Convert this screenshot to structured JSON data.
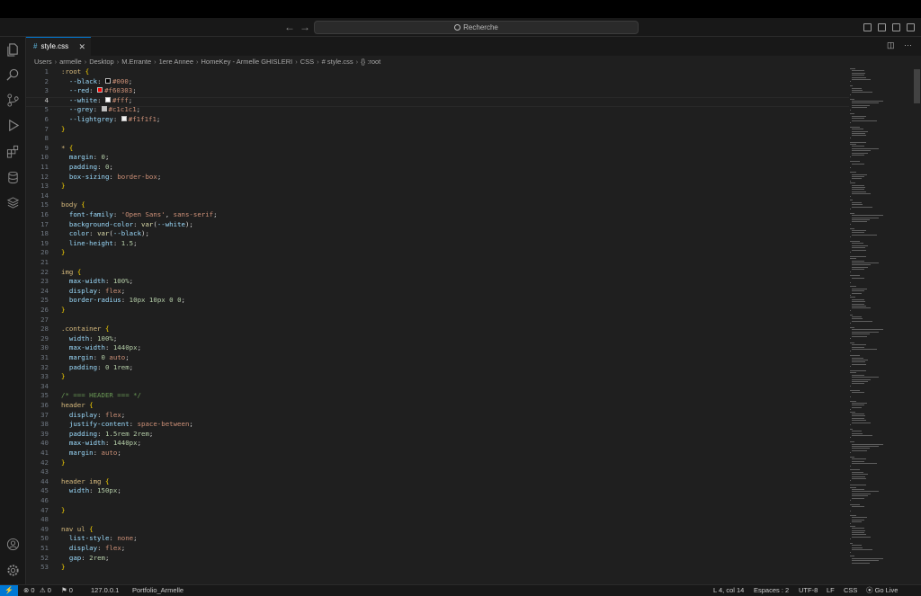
{
  "titlebar": {
    "search_placeholder": "Recherche",
    "back": "←",
    "forward": "→"
  },
  "tab": {
    "file_name": "style.css",
    "icon": "#",
    "close": "✕"
  },
  "tab_actions": {
    "split": "◫",
    "more": "···"
  },
  "breadcrumb": [
    "Users",
    "armelle",
    "Desktop",
    "M.Errante",
    "1ere Annee",
    "HomeKey - Armelle GHISLERI",
    "CSS",
    "# style.css",
    "{} :root"
  ],
  "editor": {
    "active_line": 4,
    "lines": [
      [
        [
          "t-sel",
          ":root "
        ],
        [
          "t-brace",
          "{"
        ]
      ],
      [
        [
          "",
          "  "
        ],
        [
          "t-prop",
          "--black"
        ],
        [
          "t-punc",
          ": "
        ],
        [
          "sw:#000000",
          ""
        ],
        [
          "t-val",
          "#000"
        ],
        [
          "t-punc",
          ";"
        ]
      ],
      [
        [
          "",
          "  "
        ],
        [
          "t-prop",
          "--red"
        ],
        [
          "t-punc",
          ": "
        ],
        [
          "sw:#f60303",
          ""
        ],
        [
          "t-val",
          "#f60303"
        ],
        [
          "t-punc",
          ";"
        ]
      ],
      [
        [
          "",
          "  "
        ],
        [
          "t-prop",
          "--white"
        ],
        [
          "t-punc",
          ": "
        ],
        [
          "sw:#ffffff",
          ""
        ],
        [
          "t-val",
          "#fff"
        ],
        [
          "t-punc",
          ";"
        ]
      ],
      [
        [
          "",
          "  "
        ],
        [
          "t-prop",
          "--grey"
        ],
        [
          "t-punc",
          ": "
        ],
        [
          "sw:#c1c1c1",
          ""
        ],
        [
          "t-val",
          "#c1c1c1"
        ],
        [
          "t-punc",
          ";"
        ]
      ],
      [
        [
          "",
          "  "
        ],
        [
          "t-prop",
          "--lightgrey"
        ],
        [
          "t-punc",
          ": "
        ],
        [
          "sw:#f1f1f1",
          ""
        ],
        [
          "t-val",
          "#f1f1f1"
        ],
        [
          "t-punc",
          ";"
        ]
      ],
      [
        [
          "t-brace",
          "}"
        ]
      ],
      [],
      [
        [
          "t-sel",
          "* "
        ],
        [
          "t-brace",
          "{"
        ]
      ],
      [
        [
          "",
          "  "
        ],
        [
          "t-prop",
          "margin"
        ],
        [
          "t-punc",
          ": "
        ],
        [
          "t-num",
          "0"
        ],
        [
          "t-punc",
          ";"
        ]
      ],
      [
        [
          "",
          "  "
        ],
        [
          "t-prop",
          "padding"
        ],
        [
          "t-punc",
          ": "
        ],
        [
          "t-num",
          "0"
        ],
        [
          "t-punc",
          ";"
        ]
      ],
      [
        [
          "",
          "  "
        ],
        [
          "t-prop",
          "box-sizing"
        ],
        [
          "t-punc",
          ": "
        ],
        [
          "t-val",
          "border-box"
        ],
        [
          "t-punc",
          ";"
        ]
      ],
      [
        [
          "t-brace",
          "}"
        ]
      ],
      [],
      [
        [
          "t-sel",
          "body "
        ],
        [
          "t-brace",
          "{"
        ]
      ],
      [
        [
          "",
          "  "
        ],
        [
          "t-prop",
          "font-family"
        ],
        [
          "t-punc",
          ": "
        ],
        [
          "t-val",
          "'Open Sans'"
        ],
        [
          "t-punc",
          ", "
        ],
        [
          "t-val",
          "sans-serif"
        ],
        [
          "t-punc",
          ";"
        ]
      ],
      [
        [
          "",
          "  "
        ],
        [
          "t-prop",
          "background-color"
        ],
        [
          "t-punc",
          ": "
        ],
        [
          "t-fn",
          "var"
        ],
        [
          "t-punc",
          "("
        ],
        [
          "t-prop",
          "--white"
        ],
        [
          "t-punc",
          ");"
        ]
      ],
      [
        [
          "",
          "  "
        ],
        [
          "t-prop",
          "color"
        ],
        [
          "t-punc",
          ": "
        ],
        [
          "t-fn",
          "var"
        ],
        [
          "t-punc",
          "("
        ],
        [
          "t-prop",
          "--black"
        ],
        [
          "t-punc",
          ");"
        ]
      ],
      [
        [
          "",
          "  "
        ],
        [
          "t-prop",
          "line-height"
        ],
        [
          "t-punc",
          ": "
        ],
        [
          "t-num",
          "1.5"
        ],
        [
          "t-punc",
          ";"
        ]
      ],
      [
        [
          "t-brace",
          "}"
        ]
      ],
      [],
      [
        [
          "t-sel",
          "img "
        ],
        [
          "t-brace",
          "{"
        ]
      ],
      [
        [
          "",
          "  "
        ],
        [
          "t-prop",
          "max-width"
        ],
        [
          "t-punc",
          ": "
        ],
        [
          "t-num",
          "100%"
        ],
        [
          "t-punc",
          ";"
        ]
      ],
      [
        [
          "",
          "  "
        ],
        [
          "t-prop",
          "display"
        ],
        [
          "t-punc",
          ": "
        ],
        [
          "t-val",
          "flex"
        ],
        [
          "t-punc",
          ";"
        ]
      ],
      [
        [
          "",
          "  "
        ],
        [
          "t-prop",
          "border-radius"
        ],
        [
          "t-punc",
          ": "
        ],
        [
          "t-num",
          "10px 10px 0 0"
        ],
        [
          "t-punc",
          ";"
        ]
      ],
      [
        [
          "t-brace",
          "}"
        ]
      ],
      [],
      [
        [
          "t-sel",
          ".container "
        ],
        [
          "t-brace",
          "{"
        ]
      ],
      [
        [
          "",
          "  "
        ],
        [
          "t-prop",
          "width"
        ],
        [
          "t-punc",
          ": "
        ],
        [
          "t-num",
          "100%"
        ],
        [
          "t-punc",
          ";"
        ]
      ],
      [
        [
          "",
          "  "
        ],
        [
          "t-prop",
          "max-width"
        ],
        [
          "t-punc",
          ": "
        ],
        [
          "t-num",
          "1440px"
        ],
        [
          "t-punc",
          ";"
        ]
      ],
      [
        [
          "",
          "  "
        ],
        [
          "t-prop",
          "margin"
        ],
        [
          "t-punc",
          ": "
        ],
        [
          "t-num",
          "0"
        ],
        [
          "t-val",
          " auto"
        ],
        [
          "t-punc",
          ";"
        ]
      ],
      [
        [
          "",
          "  "
        ],
        [
          "t-prop",
          "padding"
        ],
        [
          "t-punc",
          ": "
        ],
        [
          "t-num",
          "0 1rem"
        ],
        [
          "t-punc",
          ";"
        ]
      ],
      [
        [
          "t-brace",
          "}"
        ]
      ],
      [],
      [
        [
          "t-comment",
          "/* === HEADER === */"
        ]
      ],
      [
        [
          "t-sel",
          "header "
        ],
        [
          "t-brace",
          "{"
        ]
      ],
      [
        [
          "",
          "  "
        ],
        [
          "t-prop",
          "display"
        ],
        [
          "t-punc",
          ": "
        ],
        [
          "t-val",
          "flex"
        ],
        [
          "t-punc",
          ";"
        ]
      ],
      [
        [
          "",
          "  "
        ],
        [
          "t-prop",
          "justify-content"
        ],
        [
          "t-punc",
          ": "
        ],
        [
          "t-val",
          "space-between"
        ],
        [
          "t-punc",
          ";"
        ]
      ],
      [
        [
          "",
          "  "
        ],
        [
          "t-prop",
          "padding"
        ],
        [
          "t-punc",
          ": "
        ],
        [
          "t-num",
          "1.5rem 2rem"
        ],
        [
          "t-punc",
          ";"
        ]
      ],
      [
        [
          "",
          "  "
        ],
        [
          "t-prop",
          "max-width"
        ],
        [
          "t-punc",
          ": "
        ],
        [
          "t-num",
          "1440px"
        ],
        [
          "t-punc",
          ";"
        ]
      ],
      [
        [
          "",
          "  "
        ],
        [
          "t-prop",
          "margin"
        ],
        [
          "t-punc",
          ": "
        ],
        [
          "t-val",
          "auto"
        ],
        [
          "t-punc",
          ";"
        ]
      ],
      [
        [
          "t-brace",
          "}"
        ]
      ],
      [],
      [
        [
          "t-sel",
          "header img "
        ],
        [
          "t-brace",
          "{"
        ]
      ],
      [
        [
          "",
          "  "
        ],
        [
          "t-prop",
          "width"
        ],
        [
          "t-punc",
          ": "
        ],
        [
          "t-num",
          "150px"
        ],
        [
          "t-punc",
          ";"
        ]
      ],
      [],
      [
        [
          "t-brace",
          "}"
        ]
      ],
      [],
      [
        [
          "t-sel",
          "nav ul "
        ],
        [
          "t-brace",
          "{"
        ]
      ],
      [
        [
          "",
          "  "
        ],
        [
          "t-prop",
          "list-style"
        ],
        [
          "t-punc",
          ": "
        ],
        [
          "t-val",
          "none"
        ],
        [
          "t-punc",
          ";"
        ]
      ],
      [
        [
          "",
          "  "
        ],
        [
          "t-prop",
          "display"
        ],
        [
          "t-punc",
          ": "
        ],
        [
          "t-val",
          "flex"
        ],
        [
          "t-punc",
          ";"
        ]
      ],
      [
        [
          "",
          "  "
        ],
        [
          "t-prop",
          "gap"
        ],
        [
          "t-punc",
          ": "
        ],
        [
          "t-num",
          "2rem"
        ],
        [
          "t-punc",
          ";"
        ]
      ],
      [
        [
          "t-brace",
          "}"
        ]
      ]
    ]
  },
  "statusbar": {
    "remote_icon": "⚡",
    "errors": "⊗ 0",
    "warnings": "⚠ 0",
    "ports": "⚑ 0",
    "server": "127.0.0.1",
    "project": "Portfolio_Armelle",
    "cursor": "L 4, col 14",
    "spaces": "Espaces : 2",
    "encoding": "UTF-8",
    "eol": "LF",
    "language": "CSS",
    "golive": "Go Live"
  },
  "activity_icons": [
    "explorer-icon",
    "search-icon",
    "source-control-icon",
    "run-debug-icon",
    "extensions-icon",
    "database-icon",
    "layers-icon",
    "account-icon",
    "settings-icon"
  ]
}
